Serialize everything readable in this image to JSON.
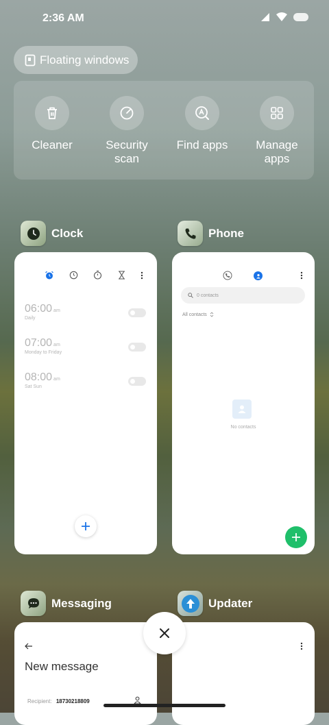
{
  "status_bar": {
    "time": "2:36 AM"
  },
  "floating_windows": {
    "label": "Floating windows"
  },
  "quick_actions": [
    {
      "label": "Cleaner",
      "icon": "trash-icon"
    },
    {
      "label": "Security\nscan",
      "icon": "security-scan-icon"
    },
    {
      "label": "Find apps",
      "icon": "find-apps-icon"
    },
    {
      "label": "Manage\napps",
      "icon": "grid-icon"
    }
  ],
  "apps": {
    "clock": {
      "name": "Clock",
      "alarms": [
        {
          "time": "06:00",
          "ampm": "am",
          "repeat": "Daily"
        },
        {
          "time": "07:00",
          "ampm": "am",
          "repeat": "Monday to Friday"
        },
        {
          "time": "08:00",
          "ampm": "am",
          "repeat": "Sat Sun"
        }
      ],
      "accent": "#1a73e8"
    },
    "phone": {
      "name": "Phone",
      "search_placeholder": "0 contacts",
      "filter": "All contacts",
      "empty_text": "No contacts",
      "fab_color": "#1fbf6a"
    },
    "messaging": {
      "name": "Messaging",
      "title": "New message",
      "recipient_label": "Recipient:",
      "recipient_value": "18730218809"
    },
    "updater": {
      "name": "Updater"
    }
  }
}
